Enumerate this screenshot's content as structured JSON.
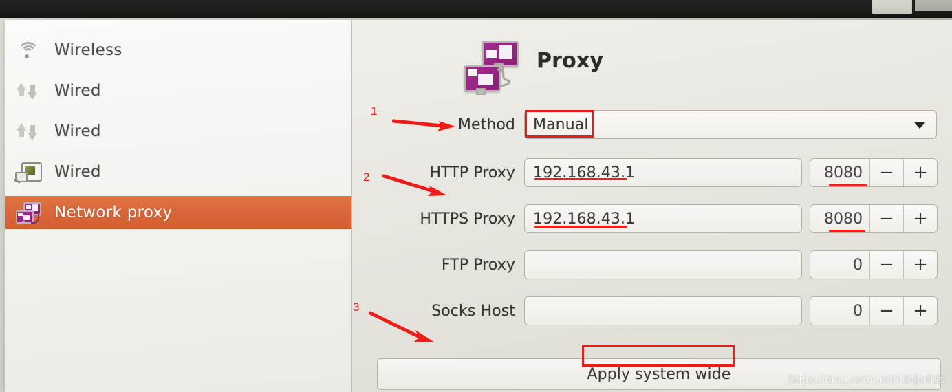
{
  "window": {
    "title": "Proxy",
    "title_icon": "network-proxy-icon"
  },
  "sidebar": {
    "items": [
      {
        "label": "Wireless",
        "icon": "wifi-icon",
        "selected": false
      },
      {
        "label": "Wired",
        "icon": "up-down-arrows-icon",
        "selected": false
      },
      {
        "label": "Wired",
        "icon": "up-down-arrows-icon",
        "selected": false
      },
      {
        "label": "Wired",
        "icon": "network-card-icon",
        "selected": false
      },
      {
        "label": "Network proxy",
        "icon": "network-proxy-icon",
        "selected": true
      }
    ],
    "selected_bg": "#d9663a"
  },
  "form": {
    "method": {
      "label": "Method",
      "value": "Manual",
      "caret_icon": "chevron-down-icon"
    },
    "rows": [
      {
        "label": "HTTP Proxy",
        "value": "192.168.43.1",
        "placeholder": "",
        "port": "8080"
      },
      {
        "label": "HTTPS Proxy",
        "value": "192.168.43.1",
        "placeholder": "",
        "port": "8080"
      },
      {
        "label": "FTP Proxy",
        "value": "",
        "placeholder": "",
        "port": "0"
      },
      {
        "label": "Socks Host",
        "value": "",
        "placeholder": "",
        "port": "0"
      }
    ],
    "spinner": {
      "minus_label": "−",
      "plus_label": "+"
    },
    "apply_button": "Apply system wide"
  },
  "annotations": {
    "color": "#ee1c18",
    "markers": [
      {
        "number": "1",
        "points_to": "Method"
      },
      {
        "number": "2",
        "points_to": "HTTP Proxy"
      },
      {
        "number": "3",
        "points_to": "Apply system wide"
      }
    ]
  },
  "watermark": "https://blog.csdn.net/klsjadkls"
}
